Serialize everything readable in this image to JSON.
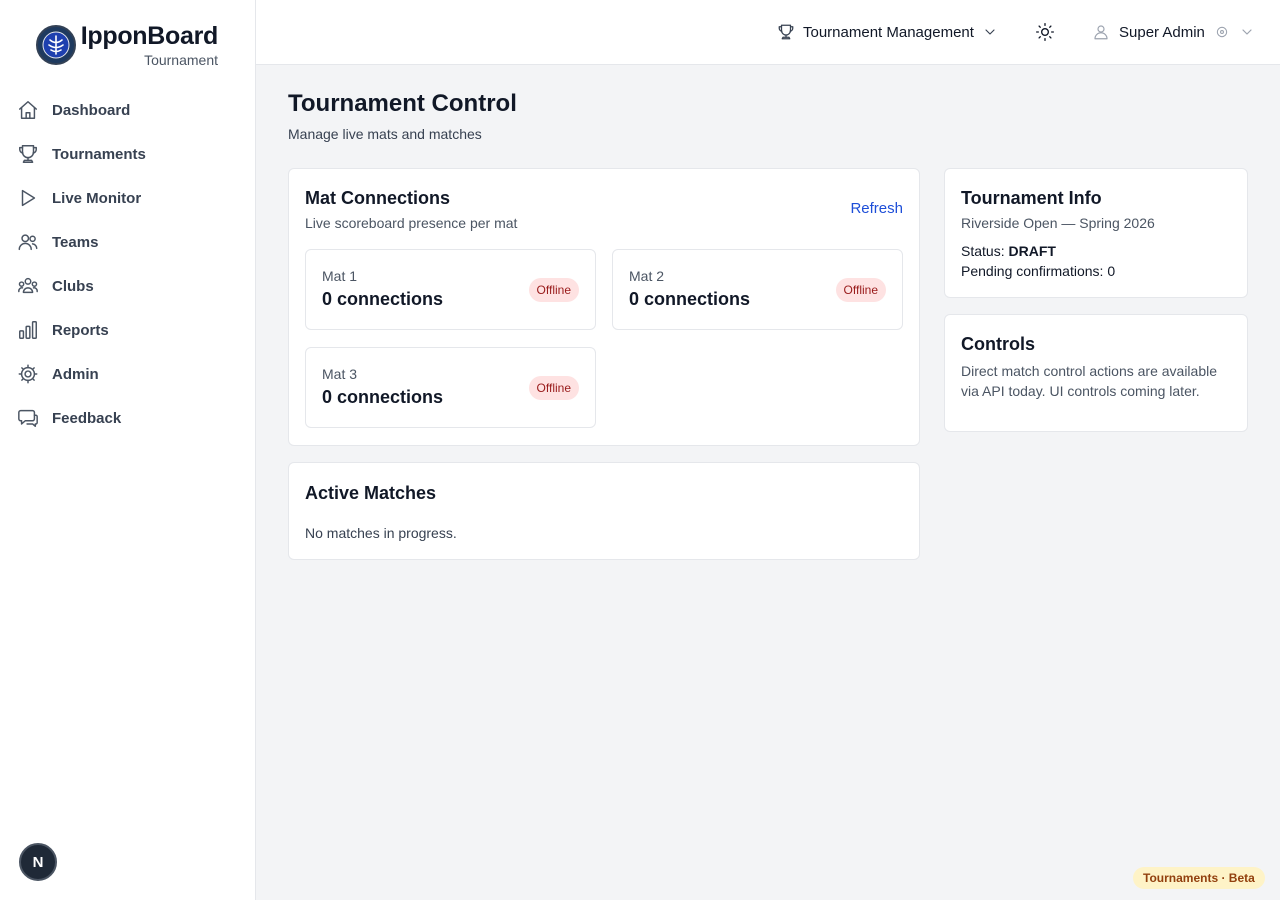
{
  "brand": {
    "name": "IpponBoard",
    "subtitle": "Tournament"
  },
  "sidebar": {
    "items": [
      {
        "label": "Dashboard",
        "icon": "home-icon"
      },
      {
        "label": "Tournaments",
        "icon": "trophy-icon"
      },
      {
        "label": "Live Monitor",
        "icon": "play-icon"
      },
      {
        "label": "Teams",
        "icon": "users-icon"
      },
      {
        "label": "Clubs",
        "icon": "group-icon"
      },
      {
        "label": "Reports",
        "icon": "bar-chart-icon"
      },
      {
        "label": "Admin",
        "icon": "gear-icon"
      },
      {
        "label": "Feedback",
        "icon": "chat-icon"
      }
    ],
    "dev_badge": "N"
  },
  "topbar": {
    "section_select": "Tournament Management",
    "user_name": "Super Admin"
  },
  "page": {
    "title": "Tournament Control",
    "subtitle": "Manage live mats and matches"
  },
  "mat_connections": {
    "title": "Mat Connections",
    "subtitle": "Live scoreboard presence per mat",
    "refresh_label": "Refresh",
    "mats": [
      {
        "name": "Mat 1",
        "connections": "0 connections",
        "status": "Offline"
      },
      {
        "name": "Mat 2",
        "connections": "0 connections",
        "status": "Offline"
      },
      {
        "name": "Mat 3",
        "connections": "0 connections",
        "status": "Offline"
      }
    ]
  },
  "active_matches": {
    "title": "Active Matches",
    "empty_text": "No matches in progress."
  },
  "tournament_info": {
    "title": "Tournament Info",
    "name": "Riverside Open — Spring 2026",
    "status_label": "Status:",
    "status_value": "DRAFT",
    "pending_label": "Pending confirmations:",
    "pending_value": "0"
  },
  "controls": {
    "title": "Controls",
    "text": "Direct match control actions are available via API today. UI controls coming later."
  },
  "footer_badge": "Tournaments · Beta",
  "colors": {
    "accent_link": "#1d4ed8",
    "offline_bg": "#fee2e2",
    "offline_text": "#991b1b",
    "beta_bg": "#fef3c7",
    "beta_text": "#92400e"
  }
}
